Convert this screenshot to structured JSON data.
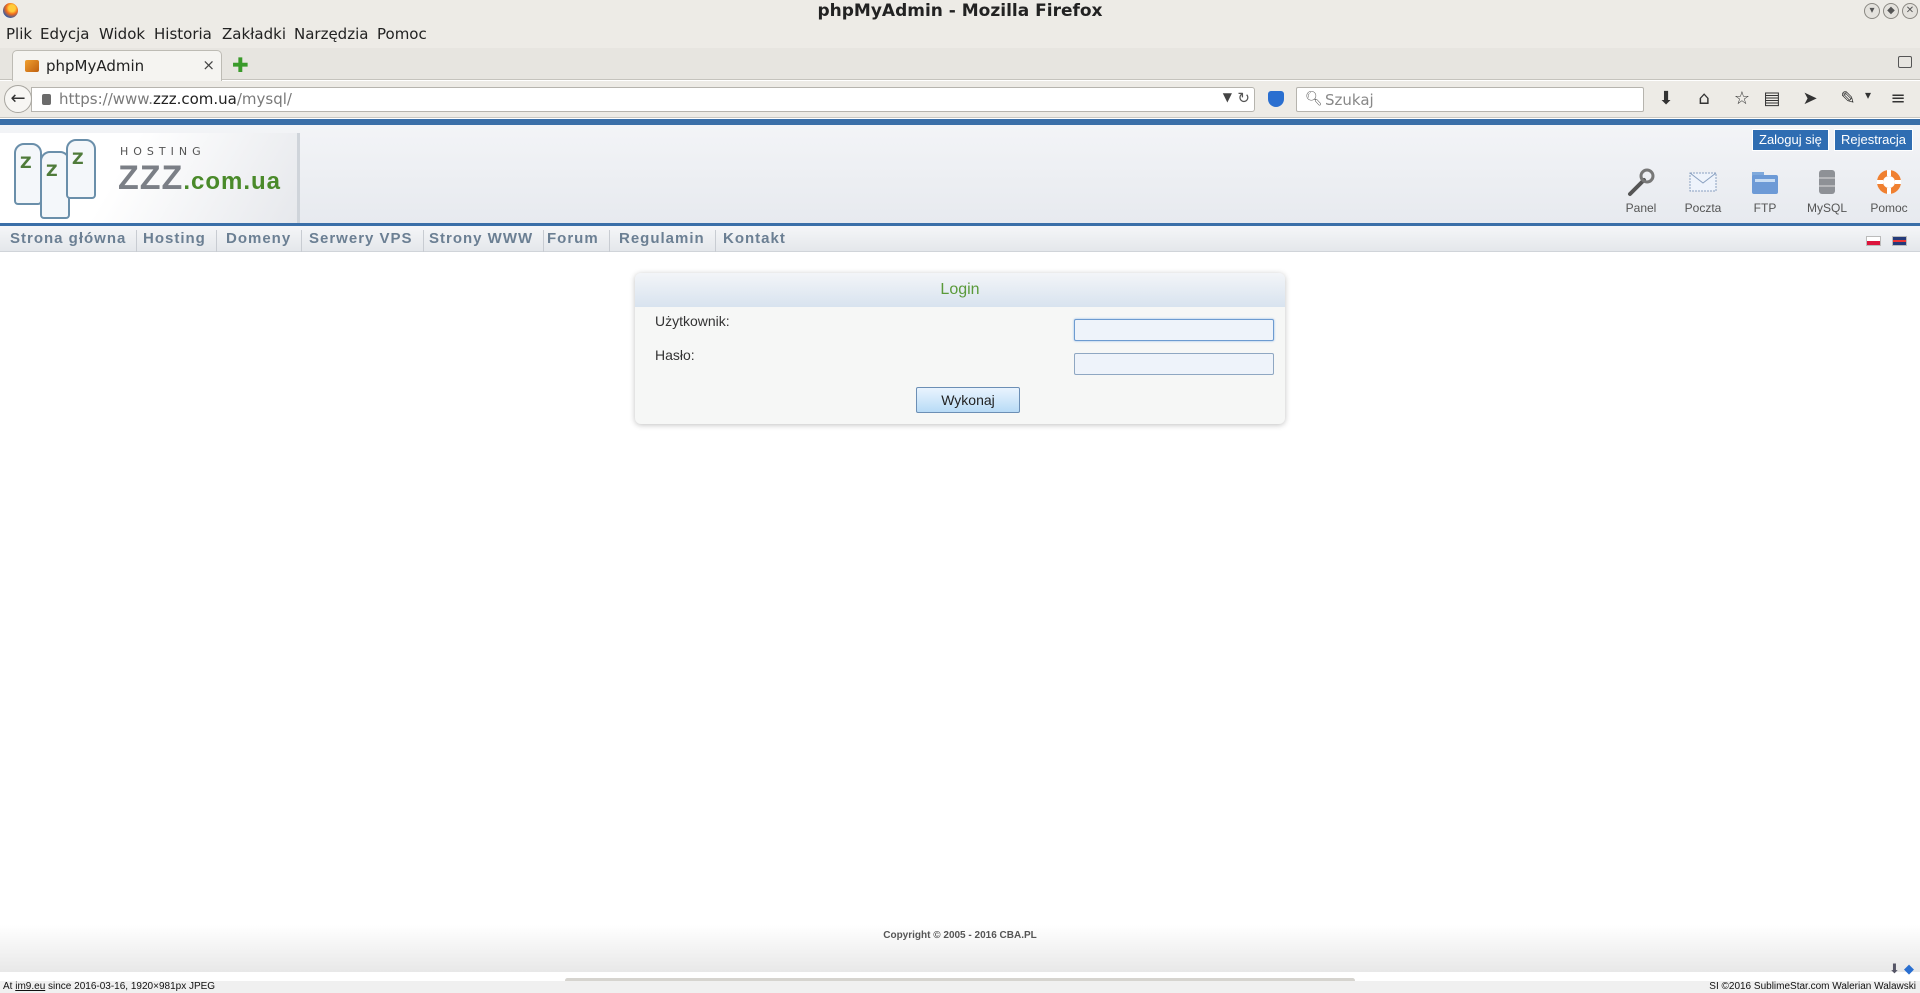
{
  "window": {
    "title": "phpMyAdmin - Mozilla Firefox"
  },
  "menu": [
    "Plik",
    "Edycja",
    "Widok",
    "Historia",
    "Zakładki",
    "Narzędzia",
    "Pomoc"
  ],
  "tab": {
    "title": "phpMyAdmin",
    "close_glyph": "×",
    "new_tab_glyph": "✚"
  },
  "navbar": {
    "url_prefix": "https://www.",
    "url_domain": "zzz.com.ua",
    "url_path": "/mysql/",
    "search_placeholder": "Szukaj"
  },
  "site_header": {
    "logo_top": "HOSTING",
    "logo_brand_main": "ZZZ",
    "logo_brand_suffix": ".com.ua",
    "login_button": "Zaloguj się",
    "register_button": "Rejestracja",
    "icons": [
      "Panel",
      "Poczta",
      "FTP",
      "MySQL",
      "Pomoc"
    ]
  },
  "site_nav": [
    "Strona główna",
    "Hosting",
    "Domeny",
    "Serwery VPS",
    "Strony WWW",
    "Forum",
    "Regulamin",
    "Kontakt"
  ],
  "login": {
    "title": "Login",
    "username_label": "Użytkownik:",
    "username_value": "",
    "password_label": "Hasło:",
    "password_value": "",
    "submit_label": "Wykonaj"
  },
  "footer": {
    "copyright": "Copyright © 2005 - 2016 CBA.PL"
  },
  "caption": {
    "left_prefix": "At ",
    "left_site": "im9.eu",
    "left_rest": " since 2016-03-16, 1920×981px JPEG",
    "right": "SI ©2016 SublimeStar.com Walerian Walawski"
  },
  "colors": {
    "accent_blue": "#3a6fa8",
    "login_title_green": "#5a9a3a"
  }
}
